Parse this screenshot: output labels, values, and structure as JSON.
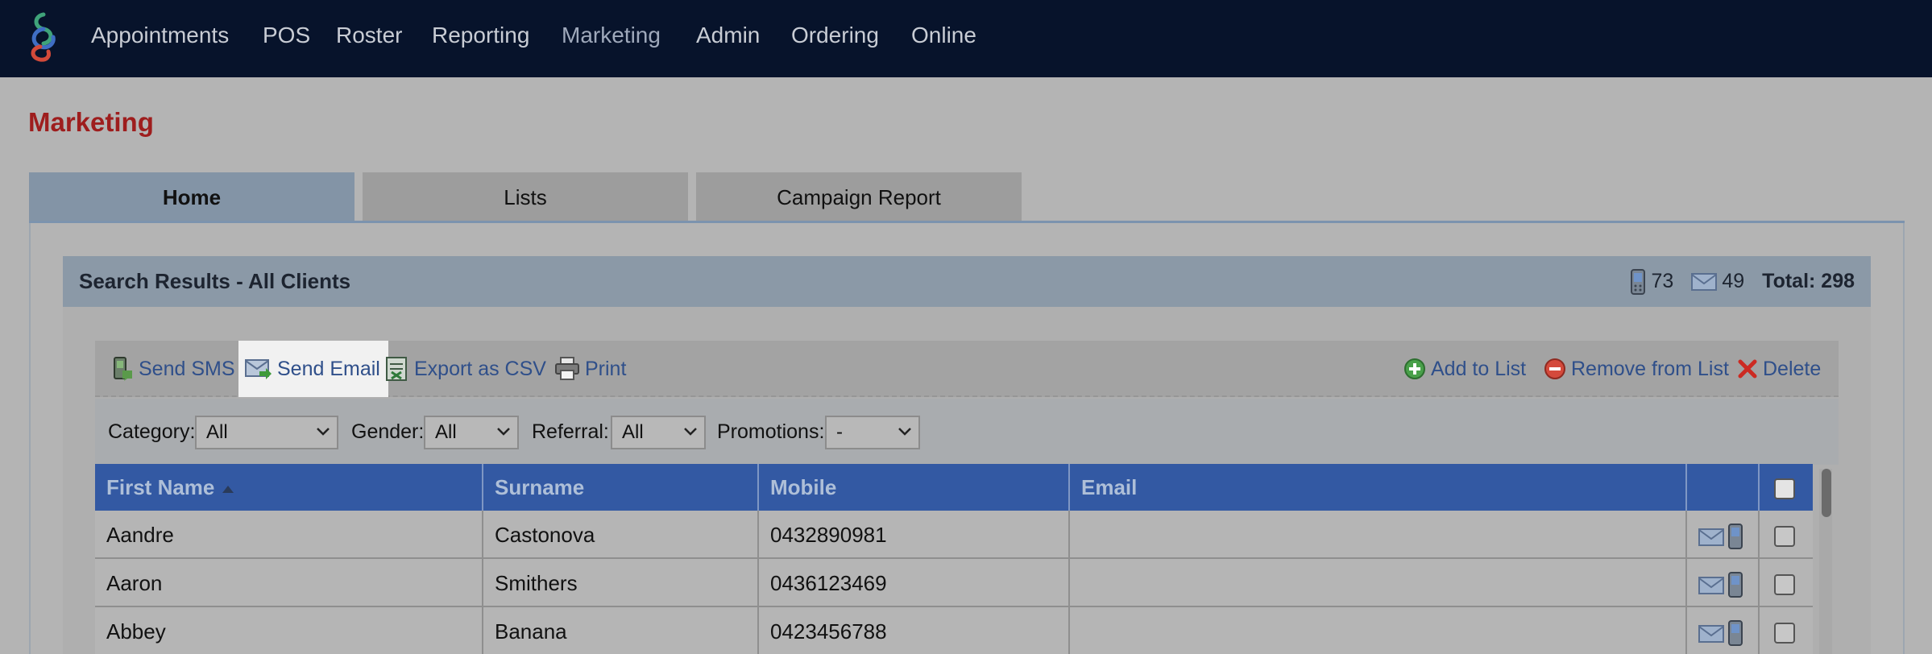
{
  "nav": {
    "items": [
      "Appointments",
      "POS",
      "Roster",
      "Reporting",
      "Marketing",
      "Admin",
      "Ordering",
      "Online"
    ],
    "active": "Marketing"
  },
  "page": {
    "title": "Marketing"
  },
  "tabs": [
    {
      "label": "Home",
      "active": true
    },
    {
      "label": "Lists",
      "active": false
    },
    {
      "label": "Campaign Report",
      "active": false
    }
  ],
  "results": {
    "title": "Search Results - All Clients",
    "mobile_count": "73",
    "email_count": "49",
    "total_label": "Total: 298"
  },
  "toolbar": {
    "send_sms": "Send SMS",
    "send_email": "Send Email",
    "export_csv": "Export as CSV",
    "print": "Print",
    "add_to_list": "Add to List",
    "remove_from_list": "Remove from List",
    "delete": "Delete"
  },
  "filters": {
    "category_label": "Category:",
    "category_value": "All",
    "gender_label": "Gender:",
    "gender_value": "All",
    "referral_label": "Referral:",
    "referral_value": "All",
    "promotions_label": "Promotions:",
    "promotions_value": "-"
  },
  "table": {
    "columns": [
      "First Name",
      "Surname",
      "Mobile",
      "Email"
    ],
    "rows": [
      {
        "first": "Aandre",
        "surname": "Castonova",
        "mobile": "0432890981",
        "email": ""
      },
      {
        "first": "Aaron",
        "surname": "Smithers",
        "mobile": "0436123469",
        "email": ""
      },
      {
        "first": "Abbey",
        "surname": "Banana",
        "mobile": "0423456788",
        "email": ""
      }
    ]
  },
  "colors": {
    "nav_bg": "#07132b",
    "title_red": "#9e1d1d",
    "header_blue": "#3359a3",
    "link_blue": "#2f4f8a"
  },
  "icons": [
    "logo-icon",
    "mobile-phone-icon",
    "envelope-icon",
    "sms-icon",
    "send-email-icon",
    "csv-export-icon",
    "printer-icon",
    "add-circle-icon",
    "remove-circle-icon",
    "delete-x-icon",
    "chevron-down-icon"
  ]
}
